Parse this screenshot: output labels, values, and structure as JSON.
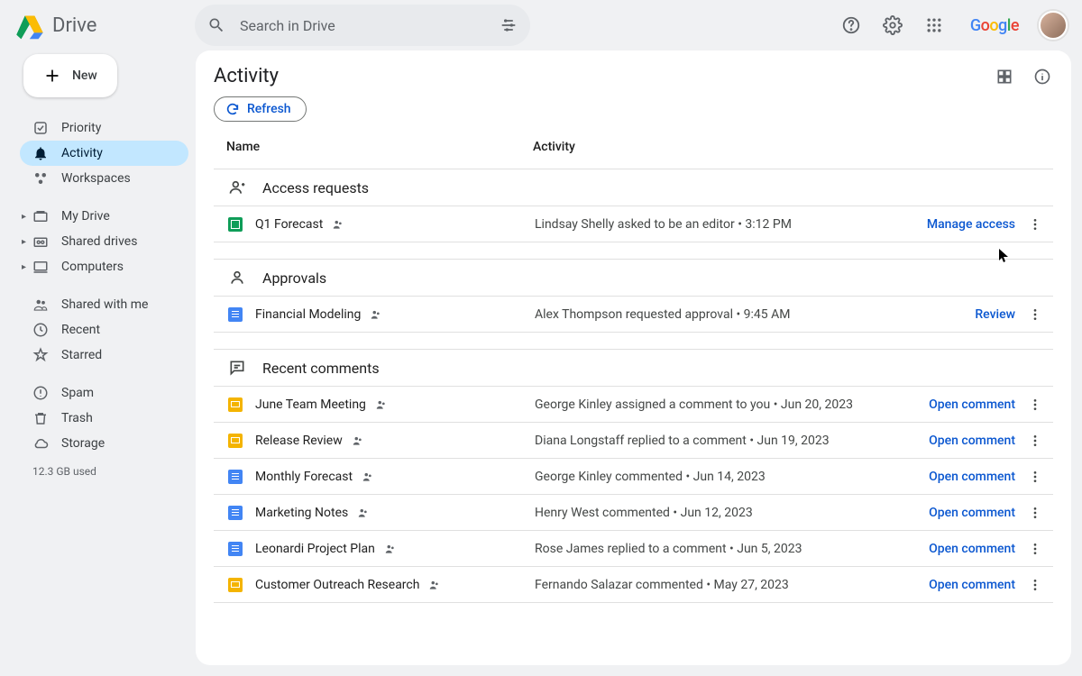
{
  "header": {
    "product": "Drive",
    "search_placeholder": "Search in Drive",
    "google_logo": "Google"
  },
  "sidebar": {
    "new_label": "New",
    "nav1": [
      {
        "label": "Priority"
      },
      {
        "label": "Activity"
      },
      {
        "label": "Workspaces"
      }
    ],
    "nav2": [
      {
        "label": "My Drive"
      },
      {
        "label": "Shared drives"
      },
      {
        "label": "Computers"
      }
    ],
    "nav3": [
      {
        "label": "Shared with me"
      },
      {
        "label": "Recent"
      },
      {
        "label": "Starred"
      }
    ],
    "nav4": [
      {
        "label": "Spam"
      },
      {
        "label": "Trash"
      },
      {
        "label": "Storage"
      }
    ],
    "storage": "12.3 GB used"
  },
  "main": {
    "title": "Activity",
    "refresh": "Refresh",
    "col_name": "Name",
    "col_activity": "Activity",
    "sections": {
      "access": {
        "title": "Access requests",
        "rows": [
          {
            "file": "Q1 Forecast",
            "type": "sheets",
            "activity": "Lindsay Shelly asked to be an editor • 3:12 PM",
            "action": "Manage access"
          }
        ]
      },
      "approvals": {
        "title": "Approvals",
        "rows": [
          {
            "file": "Financial Modeling",
            "type": "docs",
            "activity": "Alex Thompson requested approval • 9:45 AM",
            "action": "Review"
          }
        ]
      },
      "comments": {
        "title": "Recent comments",
        "rows": [
          {
            "file": "June Team Meeting",
            "type": "slides",
            "activity": "George Kinley assigned a comment to you • Jun 20, 2023",
            "action": "Open comment"
          },
          {
            "file": "Release Review",
            "type": "slides",
            "activity": "Diana Longstaff replied to a comment • Jun 19, 2023",
            "action": "Open comment"
          },
          {
            "file": "Monthly Forecast",
            "type": "docs",
            "activity": "George Kinley commented • Jun 14, 2023",
            "action": "Open comment"
          },
          {
            "file": "Marketing Notes",
            "type": "docs",
            "activity": "Henry West commented • Jun 12, 2023",
            "action": "Open comment"
          },
          {
            "file": "Leonardi Project Plan",
            "type": "docs",
            "activity": "Rose James replied to a comment • Jun 5, 2023",
            "action": "Open comment"
          },
          {
            "file": "Customer Outreach Research",
            "type": "slides",
            "activity": "Fernando Salazar commented • May 27, 2023",
            "action": "Open comment"
          }
        ]
      }
    }
  }
}
